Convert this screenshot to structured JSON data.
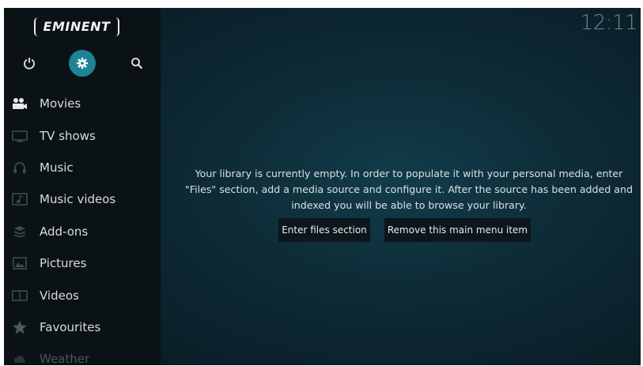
{
  "brand": {
    "logo_text": "EMINENT"
  },
  "clock": "12:11",
  "top_icons": [
    "power-icon",
    "settings-icon",
    "search-icon"
  ],
  "menu": [
    {
      "label": "Movies",
      "icon": "movies-icon"
    },
    {
      "label": "TV shows",
      "icon": "tv-icon"
    },
    {
      "label": "Music",
      "icon": "headphones-icon"
    },
    {
      "label": "Music videos",
      "icon": "music-video-icon"
    },
    {
      "label": "Add-ons",
      "icon": "addons-icon"
    },
    {
      "label": "Pictures",
      "icon": "pictures-icon"
    },
    {
      "label": "Videos",
      "icon": "videos-icon"
    },
    {
      "label": "Favourites",
      "icon": "star-icon"
    },
    {
      "label": "Weather",
      "icon": "weather-icon"
    }
  ],
  "main": {
    "message": "Your library is currently empty. In order to populate it with your personal media, enter \"Files\" section, add a media source and configure it. After the source has been added and indexed you will be able to browse your library.",
    "buttons": {
      "enter_files": "Enter files section",
      "remove_item": "Remove this main menu item"
    }
  },
  "colors": {
    "accent": "#1d8396",
    "background": "#0e2c38",
    "sidebar": "#0b1216"
  }
}
